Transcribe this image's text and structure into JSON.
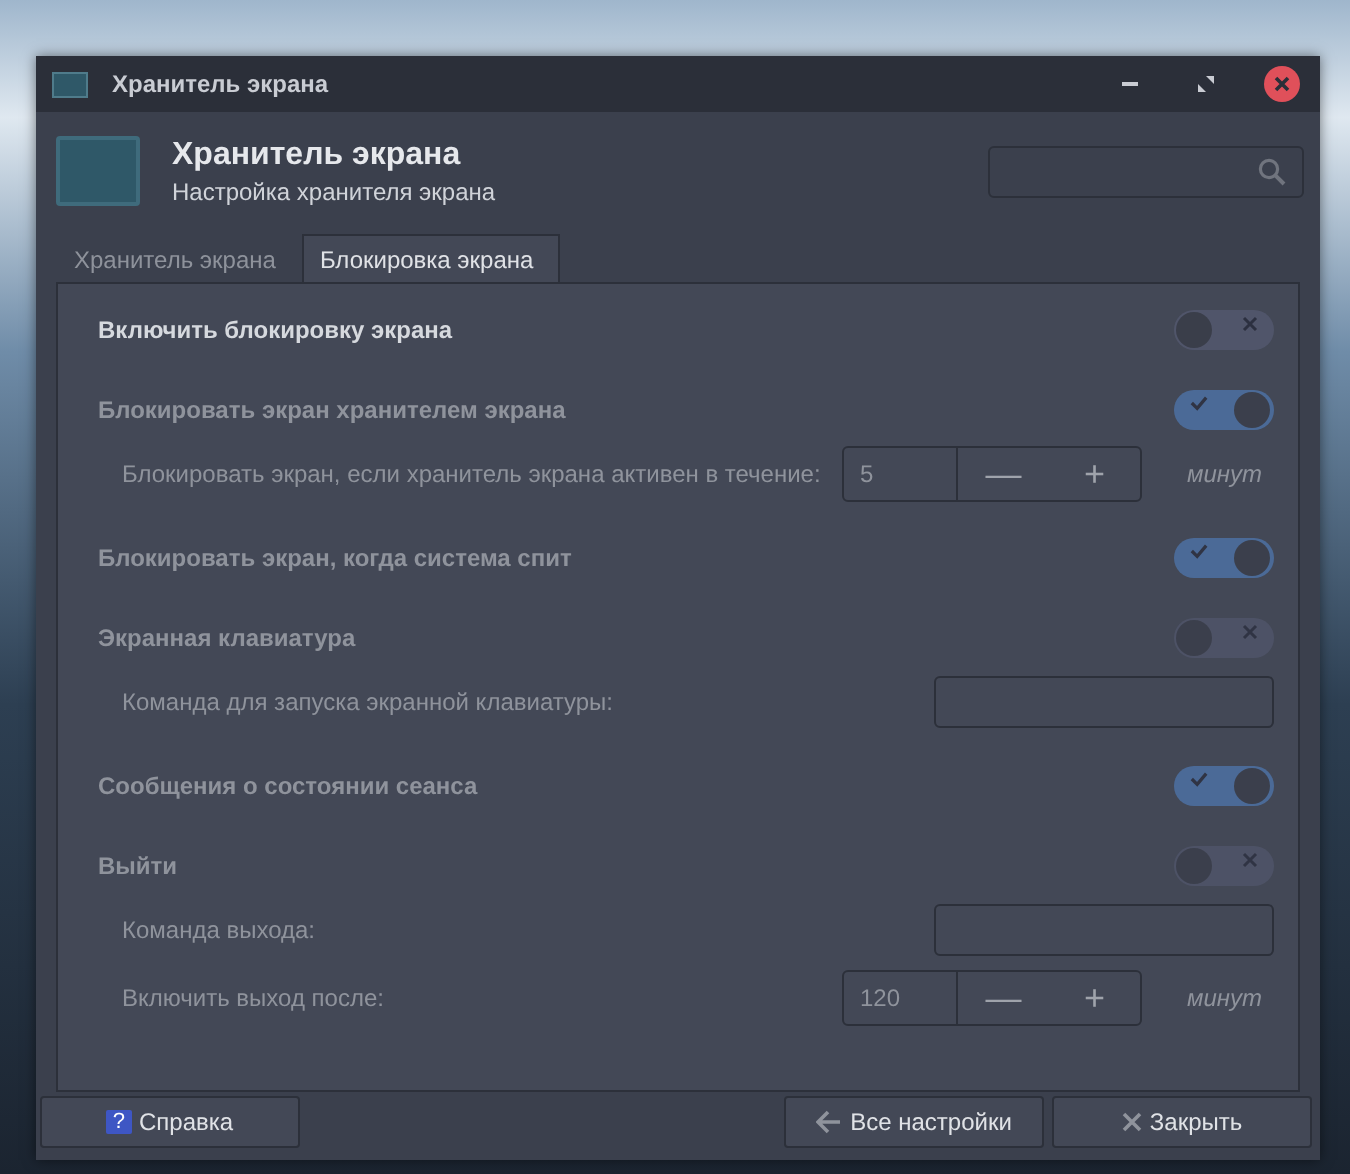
{
  "window": {
    "title": "Хранитель экрана"
  },
  "header": {
    "title": "Хранитель экрана",
    "subtitle": "Настройка хранителя экрана"
  },
  "tabs": [
    {
      "label": "Хранитель экрана",
      "selected": false
    },
    {
      "label": "Блокировка экрана",
      "selected": true
    }
  ],
  "sections": [
    {
      "label": "Включить блокировку экрана",
      "on": false,
      "disabled": false
    },
    {
      "label": "Блокировать экран хранителем экрана",
      "on": true,
      "disabled": true,
      "rows": [
        {
          "kind": "spin",
          "label": "Блокировать экран, если хранитель экрана активен в течение:",
          "value": "5",
          "minus": "—",
          "plus": "+",
          "unit": "минут"
        }
      ]
    },
    {
      "label": "Блокировать экран, когда система спит",
      "on": true,
      "disabled": true
    },
    {
      "label": "Экранная клавиатура",
      "on": false,
      "disabled": true,
      "rows": [
        {
          "kind": "text",
          "label": "Команда для запуска экранной клавиатуры:"
        }
      ]
    },
    {
      "label": "Сообщения о состоянии сеанса",
      "on": true,
      "disabled": true
    },
    {
      "label": "Выйти",
      "on": false,
      "disabled": true,
      "rows": [
        {
          "kind": "text",
          "label": "Команда выхода:"
        },
        {
          "kind": "spin",
          "label": "Включить выход после:",
          "value": "120",
          "minus": "—",
          "plus": "+",
          "unit": "минут"
        }
      ]
    }
  ],
  "buttons": [
    {
      "kind": "help",
      "label": "Справка",
      "icon": "?"
    },
    {
      "kind": "back",
      "label": "Все настройки"
    },
    {
      "kind": "close",
      "label": "Закрыть"
    }
  ]
}
